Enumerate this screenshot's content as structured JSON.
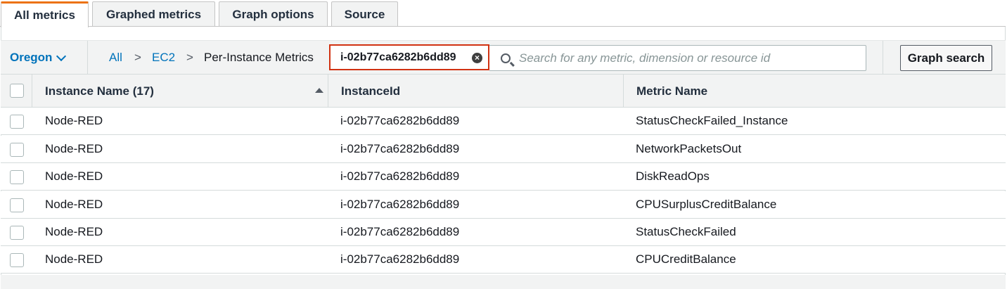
{
  "tabs": [
    {
      "label": "All metrics",
      "active": true
    },
    {
      "label": "Graphed metrics",
      "active": false
    },
    {
      "label": "Graph options",
      "active": false
    },
    {
      "label": "Source",
      "active": false
    }
  ],
  "toolbar": {
    "region": "Oregon",
    "breadcrumb": {
      "all": "All",
      "separator": ">",
      "ec2": "EC2",
      "current": "Per-Instance Metrics"
    },
    "filter_token": "i-02b77ca6282b6dd89",
    "search_placeholder": "Search for any metric, dimension or resource id",
    "graph_search_label": "Graph search"
  },
  "table": {
    "columns": [
      "Instance Name (17)",
      "InstanceId",
      "Metric Name"
    ],
    "rows": [
      {
        "name": "Node-RED",
        "id": "i-02b77ca6282b6dd89",
        "metric": "StatusCheckFailed_Instance"
      },
      {
        "name": "Node-RED",
        "id": "i-02b77ca6282b6dd89",
        "metric": "NetworkPacketsOut"
      },
      {
        "name": "Node-RED",
        "id": "i-02b77ca6282b6dd89",
        "metric": "DiskReadOps"
      },
      {
        "name": "Node-RED",
        "id": "i-02b77ca6282b6dd89",
        "metric": "CPUSurplusCreditBalance"
      },
      {
        "name": "Node-RED",
        "id": "i-02b77ca6282b6dd89",
        "metric": "StatusCheckFailed"
      },
      {
        "name": "Node-RED",
        "id": "i-02b77ca6282b6dd89",
        "metric": "CPUCreditBalance"
      }
    ]
  },
  "colors": {
    "active_tab_accent": "#ec7211",
    "link": "#0073bb",
    "token_highlight": "#d13212"
  },
  "icons": [
    "chevron-down-icon",
    "clear-icon",
    "search-icon",
    "sort-ascending-icon"
  ]
}
